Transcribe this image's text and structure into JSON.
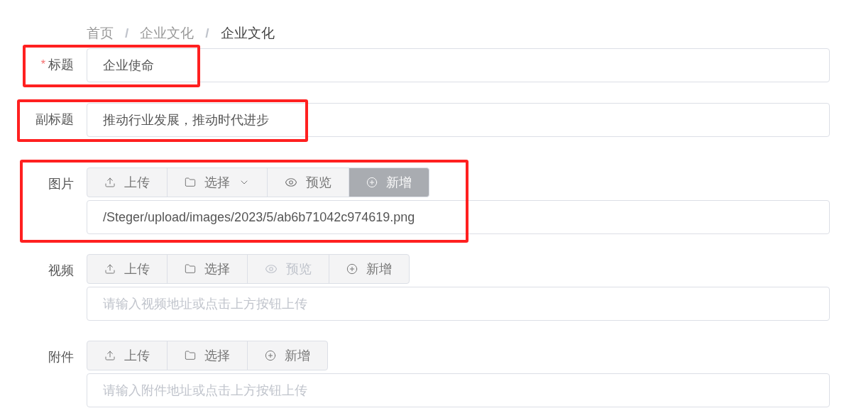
{
  "breadcrumb": [
    {
      "label": "首页",
      "current": false
    },
    {
      "label": "企业文化",
      "current": false
    },
    {
      "label": "企业文化",
      "current": true
    }
  ],
  "separator": "/",
  "fields": [
    {
      "kind": "text",
      "label": "标题",
      "required_mark": "*",
      "highlighted": true,
      "value": "企业使命"
    },
    {
      "kind": "text",
      "label": "副标题",
      "highlighted": true,
      "value": "推动行业发展，推动时代进步"
    },
    {
      "kind": "media",
      "label": "图片",
      "highlighted": true,
      "buttons": [
        {
          "kind": "upload",
          "label": "上传",
          "disabled": false,
          "pressed": false
        },
        {
          "kind": "select",
          "label": "选择",
          "disabled": false,
          "pressed": false,
          "dropdown": true
        },
        {
          "kind": "preview",
          "label": "预览",
          "disabled": false,
          "pressed": false
        },
        {
          "kind": "add",
          "label": "新增",
          "disabled": false,
          "pressed": true
        }
      ],
      "value": "/Steger/upload/images/2023/5/ab6b71042c974619.png"
    },
    {
      "kind": "media",
      "label": "视频",
      "highlighted": false,
      "buttons": [
        {
          "kind": "upload",
          "label": "上传",
          "disabled": false,
          "pressed": false
        },
        {
          "kind": "select",
          "label": "选择",
          "disabled": false,
          "pressed": false,
          "dropdown": false
        },
        {
          "kind": "preview",
          "label": "预览",
          "disabled": true,
          "pressed": false
        },
        {
          "kind": "add",
          "label": "新增",
          "disabled": false,
          "pressed": false
        }
      ],
      "placeholder": "请输入视频地址或点击上方按钮上传"
    },
    {
      "kind": "media",
      "label": "附件",
      "highlighted": false,
      "buttons": [
        {
          "kind": "upload",
          "label": "上传",
          "disabled": false,
          "pressed": false
        },
        {
          "kind": "select",
          "label": "选择",
          "disabled": false,
          "pressed": false,
          "dropdown": false
        },
        {
          "kind": "add",
          "label": "新增",
          "disabled": false,
          "pressed": false
        }
      ],
      "placeholder": "请输入附件地址或点击上方按钮上传"
    }
  ]
}
